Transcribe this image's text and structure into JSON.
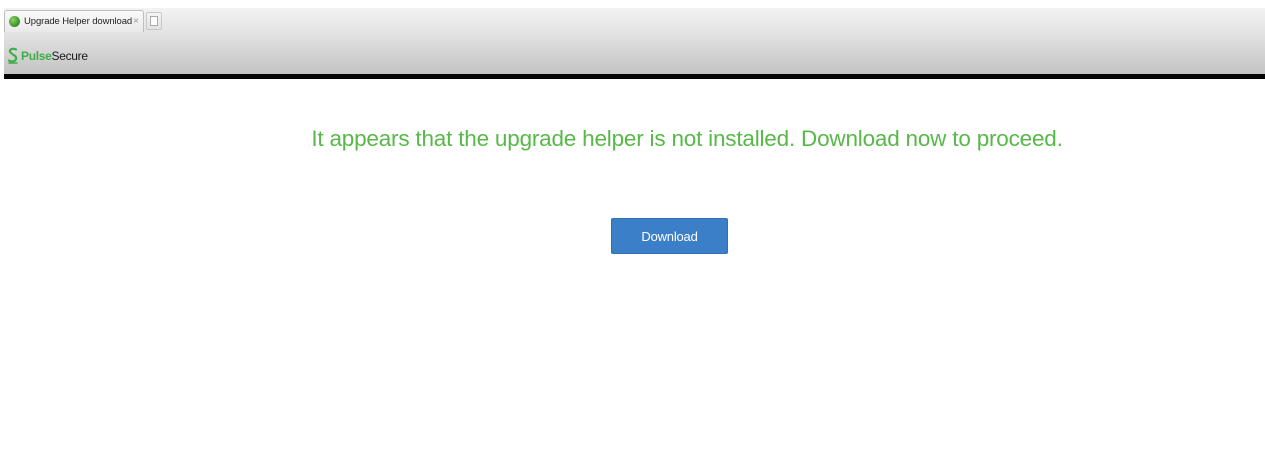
{
  "browser": {
    "tab": {
      "title": "Upgrade Helper download",
      "close_glyph": "×",
      "favicon": "globe-favicon-icon"
    },
    "new_tab_icon": "new-tab-icon"
  },
  "brand": {
    "logo_icon": "pulse-secure-logo-icon",
    "name_part1": "Pulse",
    "name_part2": "Secure",
    "accent_color": "#3fae49"
  },
  "main": {
    "message": "It appears that the upgrade helper is not installed. Download now to proceed.",
    "message_color": "#58b848",
    "download_label": "Download",
    "button_color": "#3a7fc7"
  }
}
